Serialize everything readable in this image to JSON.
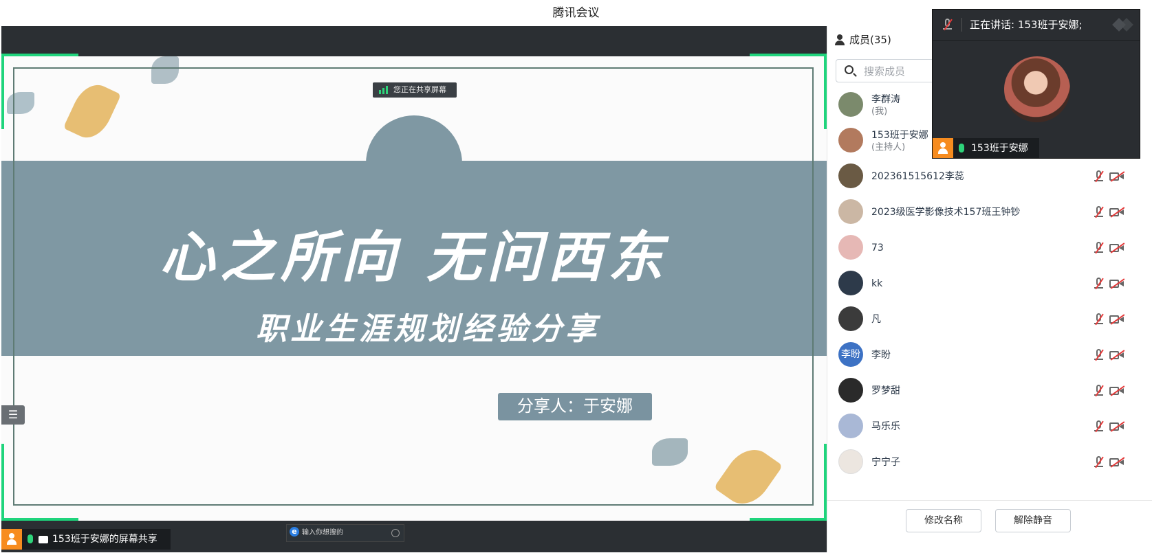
{
  "window": {
    "title": "腾讯会议"
  },
  "share": {
    "sharing_indicator": "您正在共享屏幕",
    "owner_label": "153班于安娜的屏幕共享"
  },
  "slide": {
    "title": "心之所向 无问西东",
    "subtitle": "职业生涯规划经验分享",
    "presenter": "分享人：于安娜",
    "browser_search_placeholder": "输入你想搜的"
  },
  "side_toggle": {
    "icon": "list-icon",
    "glyph": "☰"
  },
  "panel": {
    "members_tab": "成员(35)",
    "search_placeholder": "搜索成员",
    "members": [
      {
        "name": "李群涛",
        "role": "(我)",
        "avatar_color": "#7b8a6c"
      },
      {
        "name": "153班于安娜",
        "role": "(主持人)",
        "avatar_color": "#b27a5e"
      },
      {
        "name": "202361515612李蕊",
        "role": "",
        "avatar_color": "#6a5a44"
      },
      {
        "name": "2023级医学影像技术157班王钟钞",
        "role": "",
        "avatar_color": "#cbb7a4"
      },
      {
        "name": "73",
        "role": "",
        "avatar_color": "#e6b8b5"
      },
      {
        "name": "kk",
        "role": "",
        "avatar_color": "#2d3a4a"
      },
      {
        "name": "凡",
        "role": "",
        "avatar_color": "#3b3b3b"
      },
      {
        "name": "李盼",
        "role": "",
        "avatar_color": "#3d72c4",
        "avatar_text": "李盼"
      },
      {
        "name": "罗梦甜",
        "role": "",
        "avatar_color": "#2a2a2a"
      },
      {
        "name": "马乐乐",
        "role": "",
        "avatar_color": "#a9b8d6"
      },
      {
        "name": "宁宁子",
        "role": "",
        "avatar_color": "#ece6e0"
      }
    ],
    "footer": {
      "rename": "修改名称",
      "unmute": "解除静音"
    }
  },
  "floater": {
    "speaking": "正在讲话:   153班于安娜;",
    "speaker_name": "153班于安娜"
  },
  "colors": {
    "accent_green": "#1fd47c",
    "slide_band": "#7f98a3",
    "avatar_orange": "#f78c1f"
  }
}
